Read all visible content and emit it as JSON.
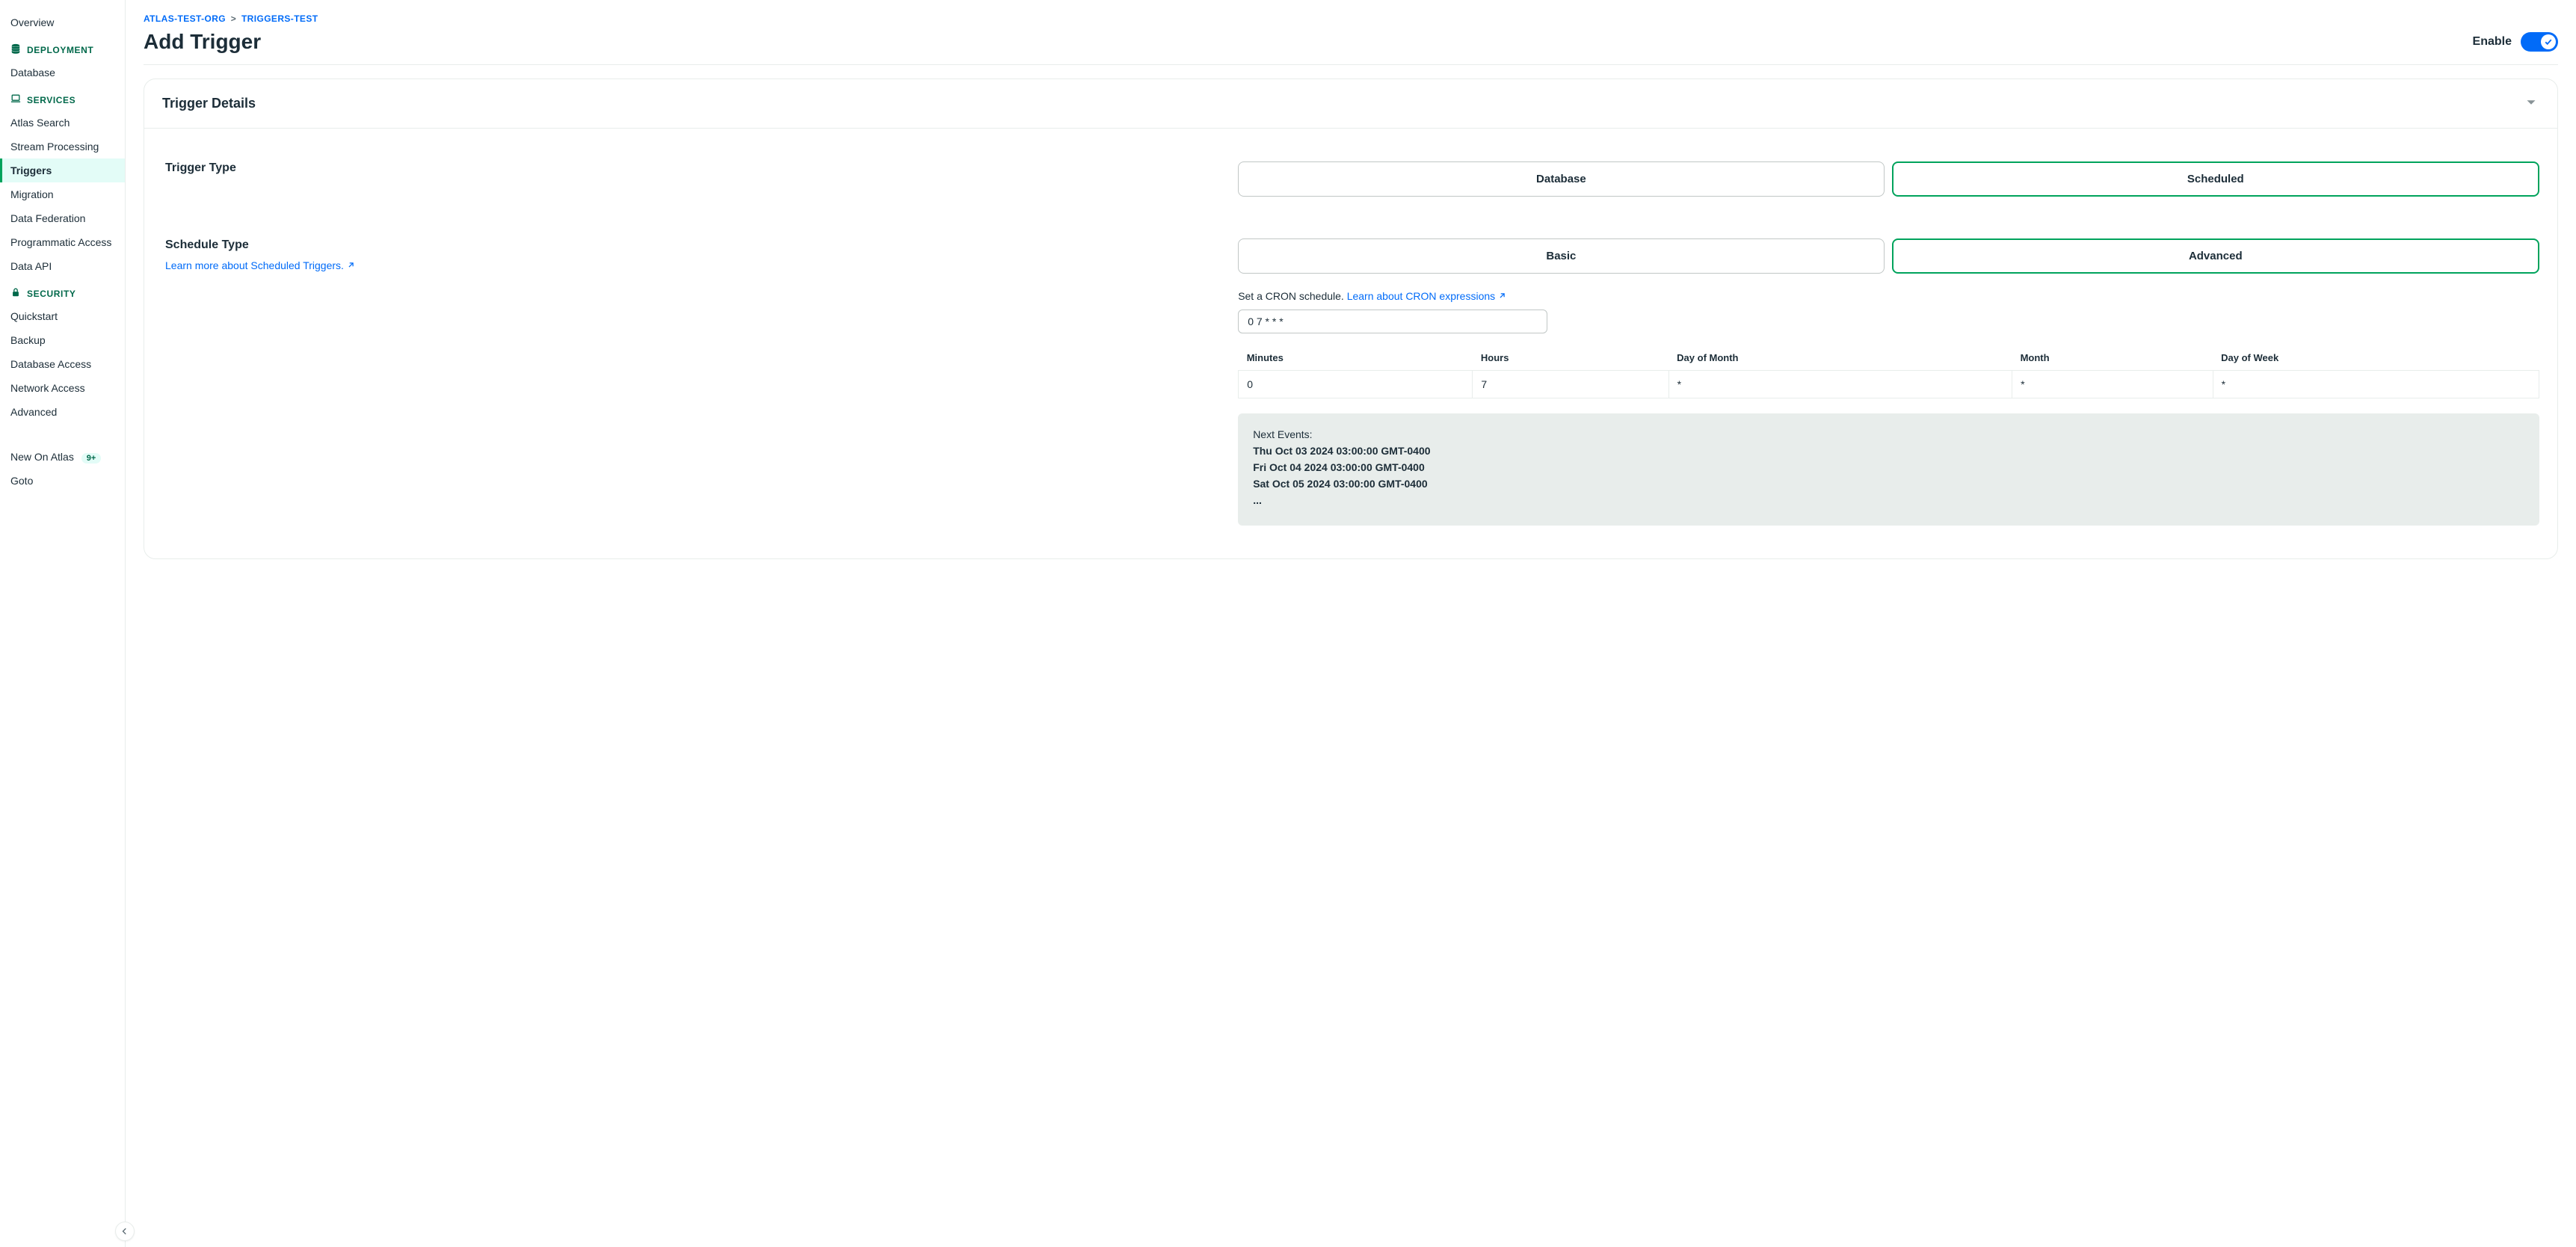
{
  "sidebar": {
    "overview": "Overview",
    "deployment_header": "DEPLOYMENT",
    "deployment_items": {
      "database": "Database"
    },
    "services_header": "SERVICES",
    "services": {
      "atlas_search": "Atlas Search",
      "stream_processing": "Stream Processing",
      "triggers": "Triggers",
      "migration": "Migration",
      "data_federation": "Data Federation",
      "programmatic_access": "Programmatic Access",
      "data_api": "Data API"
    },
    "security_header": "SECURITY",
    "security": {
      "quickstart": "Quickstart",
      "backup": "Backup",
      "database_access": "Database Access",
      "network_access": "Network Access",
      "advanced": "Advanced"
    },
    "new_on_atlas": "New On Atlas",
    "new_badge": "9+",
    "goto": "Goto"
  },
  "breadcrumb": {
    "org": "ATLAS-TEST-ORG",
    "project": "TRIGGERS-TEST",
    "sep": ">"
  },
  "page_title": "Add Trigger",
  "enable_label": "Enable",
  "card_title": "Trigger Details",
  "fields": {
    "trigger_type_label": "Trigger Type",
    "schedule_type_label": "Schedule Type",
    "learn_scheduled": "Learn more about Scheduled Triggers.",
    "cron_helper": "Set a CRON schedule.",
    "cron_learn": "Learn about CRON expressions"
  },
  "segments": {
    "trigger_type": {
      "database": "Database",
      "scheduled": "Scheduled"
    },
    "schedule_type": {
      "basic": "Basic",
      "advanced": "Advanced"
    }
  },
  "cron_value": "0 7 * * *",
  "cron_table": {
    "headers": {
      "minutes": "Minutes",
      "hours": "Hours",
      "dom": "Day of Month",
      "month": "Month",
      "dow": "Day of Week"
    },
    "values": {
      "minutes": "0",
      "hours": "7",
      "dom": "*",
      "month": "*",
      "dow": "*"
    }
  },
  "next_events": {
    "label": "Next Events:",
    "items": {
      "e0": "Thu Oct 03 2024 03:00:00 GMT-0400",
      "e1": "Fri Oct 04 2024 03:00:00 GMT-0400",
      "e2": "Sat Oct 05 2024 03:00:00 GMT-0400",
      "more": "..."
    }
  }
}
